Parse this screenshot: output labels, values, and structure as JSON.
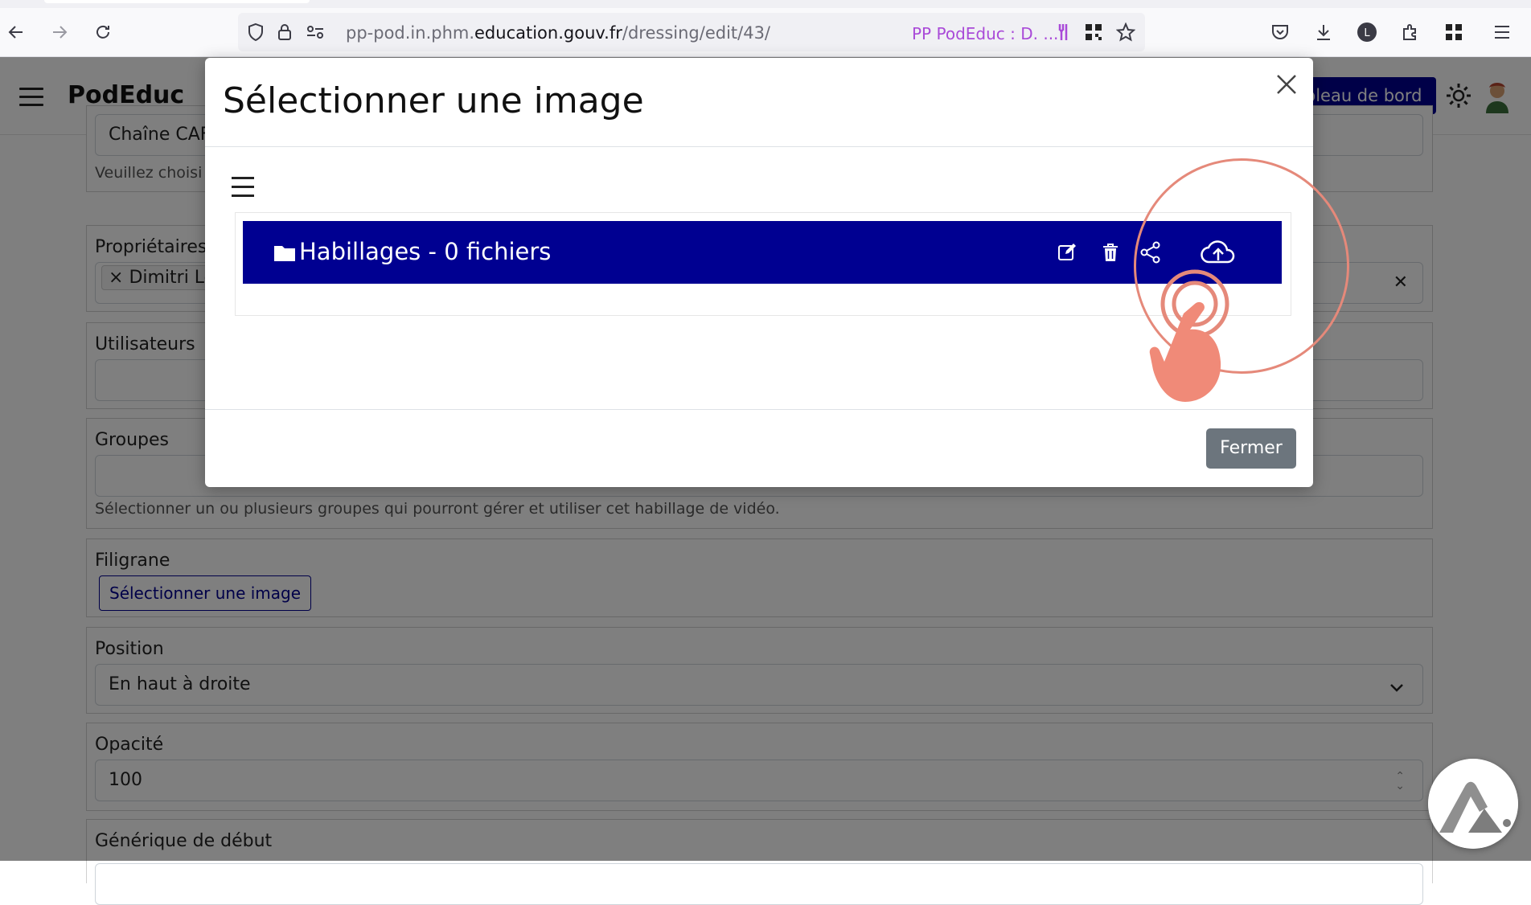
{
  "browser": {
    "url_prefix": "pp-pod.in.phm.",
    "url_domain": "education.gouv.fr",
    "url_path": "/dressing/edit/43/",
    "site_title": "PP PodEduc : D. ..."
  },
  "header": {
    "brand": "PodEduc",
    "dashboard_label": "ableau de bord"
  },
  "form": {
    "channel_value": "Chaîne CAF",
    "channel_help": "Veuillez choisi",
    "owners_label": "Propriétaires",
    "owners_chip": "Dimitri Le",
    "users_label": "Utilisateurs",
    "groups_label": "Groupes",
    "groups_help": "Sélectionner un ou plusieurs groupes qui pourront gérer et utiliser cet habillage de vidéo.",
    "watermark_label": "Filigrane",
    "watermark_button": "Sélectionner une image",
    "position_label": "Position",
    "position_value": "En haut à droite",
    "opacity_label": "Opacité",
    "opacity_value": "100",
    "opening_credits_label": "Générique de début"
  },
  "modal": {
    "title": "Sélectionner une image",
    "folder_name": "Habillages - 0 fichiers",
    "close_button": "Fermer"
  },
  "colors": {
    "primary": "#000091",
    "secondary_button": "#6c757d",
    "highlight": "#e5897a"
  }
}
